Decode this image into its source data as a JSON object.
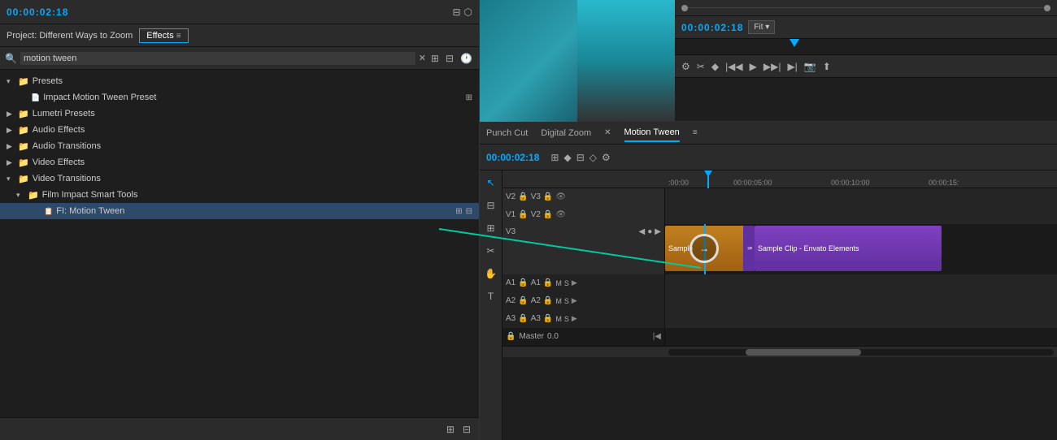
{
  "leftPanel": {
    "timecode": "00:00:02:18",
    "projectLabel": "Project: Different Ways to Zoom",
    "effectsTab": "Effects",
    "searchValue": "motion tween",
    "tree": [
      {
        "id": "presets",
        "label": "Presets",
        "level": 0,
        "type": "folder",
        "expanded": true,
        "chevron": "▾"
      },
      {
        "id": "impact-preset",
        "label": "Impact Motion Tween Preset",
        "level": 1,
        "type": "file"
      },
      {
        "id": "lumetri",
        "label": "Lumetri Presets",
        "level": 0,
        "type": "folder",
        "expanded": false,
        "chevron": "▶"
      },
      {
        "id": "audio-effects",
        "label": "Audio Effects",
        "level": 0,
        "type": "folder",
        "expanded": false,
        "chevron": "▶"
      },
      {
        "id": "audio-trans",
        "label": "Audio Transitions",
        "level": 0,
        "type": "folder",
        "expanded": false,
        "chevron": "▶"
      },
      {
        "id": "video-effects",
        "label": "Video Effects",
        "level": 0,
        "type": "folder",
        "expanded": false,
        "chevron": "▶"
      },
      {
        "id": "video-trans",
        "label": "Video Transitions",
        "level": 0,
        "type": "folder",
        "expanded": true,
        "chevron": "▾"
      },
      {
        "id": "film-impact",
        "label": "Film Impact Smart Tools",
        "level": 1,
        "type": "folder",
        "expanded": true,
        "chevron": "▾"
      },
      {
        "id": "fi-motion-tween",
        "label": "FI: Motion Tween",
        "level": 2,
        "type": "file",
        "selected": true
      }
    ]
  },
  "preview": {
    "timecode": "00:00:02:18",
    "fitLabel": "Fit",
    "tabs": [
      {
        "label": "Punch Cut"
      },
      {
        "label": "Digital Zoom"
      },
      {
        "label": "Motion Tween",
        "active": true
      }
    ]
  },
  "timeline": {
    "timecode": "00:00:02:18",
    "tracks": {
      "video": [
        {
          "name": "V2",
          "altName": "V3"
        },
        {
          "name": "V1",
          "altName": "V2"
        },
        {
          "name": "V3",
          "big": true
        }
      ],
      "audio": [
        {
          "name": "A1",
          "label": "A1",
          "m": "M",
          "s": "S"
        },
        {
          "name": "A2",
          "label": "A2",
          "m": "M",
          "s": "S"
        },
        {
          "name": "A3",
          "label": "A3",
          "m": "M",
          "s": "S"
        }
      ],
      "master": {
        "label": "Master",
        "value": "0.0"
      }
    },
    "clips": [
      {
        "label": "Sample",
        "type": "orange"
      },
      {
        "label": "fi Sample Clip - Envato Elements",
        "type": "purple"
      }
    ],
    "ruler": {
      "marks": [
        {
          "time": ":00:00",
          "pos": 0
        },
        {
          "time": "00:00:05:00",
          "pos": 25
        },
        {
          "time": "00:00:10:00",
          "pos": 50
        },
        {
          "time": "00:00:15:",
          "pos": 75
        }
      ]
    }
  }
}
